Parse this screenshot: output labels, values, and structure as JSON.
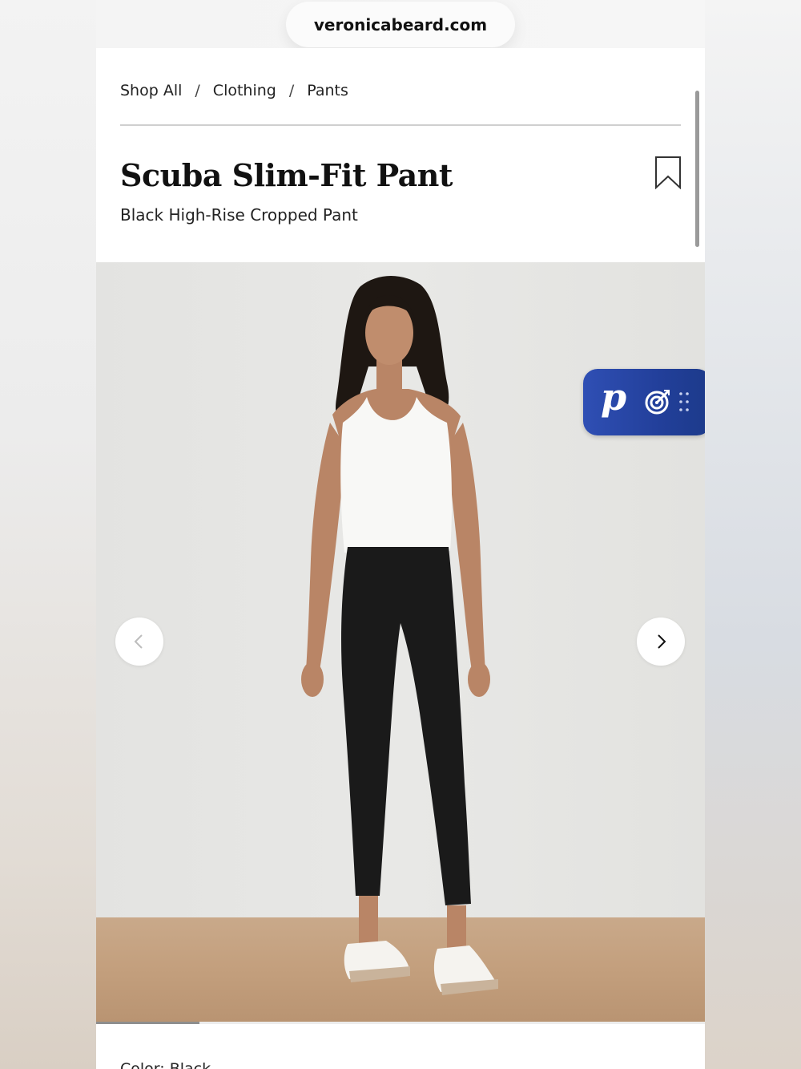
{
  "browser": {
    "url": "veronicabeard.com"
  },
  "breadcrumb": {
    "items": [
      "Shop All",
      "Clothing",
      "Pants"
    ],
    "separator": "/"
  },
  "product": {
    "title": "Scuba Slim-Fit Pant",
    "subtitle": "Black High-Rise Cropped Pant",
    "color_label": "Color: Black"
  },
  "gallery": {
    "prev_icon": "chevron-left-icon",
    "next_icon": "chevron-right-icon",
    "progress_fraction": 0.17
  },
  "widget": {
    "letter": "p",
    "icons": [
      "target-icon",
      "grip-icon"
    ],
    "color": "#2a47a8"
  },
  "icons": {
    "bookmark": "bookmark-icon"
  }
}
